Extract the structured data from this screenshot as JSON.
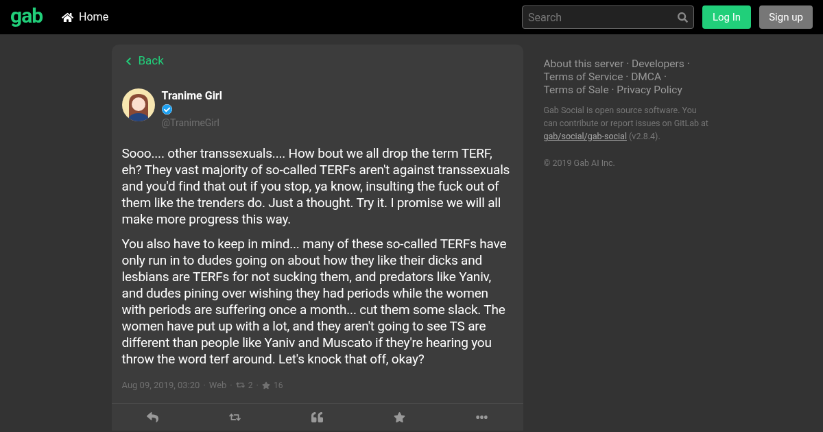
{
  "header": {
    "logo": "gab",
    "nav": [
      {
        "label": "Home",
        "selected": false
      }
    ],
    "search": {
      "placeholder": "Search"
    },
    "buttons": [
      {
        "label": "Log In",
        "kind": "primary"
      },
      {
        "label": "Sign up",
        "kind": "secondary"
      }
    ]
  },
  "post": {
    "back": "Back",
    "author": {
      "name": "Tranime Girl",
      "verified": true,
      "handle": "@TranimeGirl"
    },
    "paragraphs": [
      "Sooo.... other transsexuals.... How bout we all drop the term TERF, eh? They vast majority of so-called TERFs aren't against transsexuals and you'd find that out if you stop, ya know, insulting the fuck out of them like the trenders do. Just a thought. Try it. I promise we will all make more progress this way.",
      "You also have to keep in mind... many of these so-called TERFs have only run in to dudes going on about how they like their dicks and lesbians are TERFs for not sucking them, and predators like Yaniv, and dudes pining over wishing they had periods while the women with periods are suffering once a month... cut them some slack. The women have put up with a lot, and they aren't going to see TS are different than people like Yaniv and Muscato if they're hearing you throw the word terf around. Let's knock that off, okay?"
    ],
    "date": "Aug 09, 2019, 03:20",
    "source": "Web",
    "reposts": "2",
    "favourites": "16",
    "actions": [
      {
        "kind": "reply"
      },
      {
        "kind": "repost"
      },
      {
        "kind": "quote"
      },
      {
        "kind": "favourite"
      },
      {
        "kind": "more"
      }
    ]
  },
  "sidebar": {
    "links": [
      "About this server",
      "Developers",
      "Terms of Service",
      "DMCA",
      "Terms of Sale",
      "Privacy Policy"
    ],
    "about": {
      "text_before": "Gab Social is open source software. You can contribute or report issues on GitLab at",
      "link": "gab/social/gab-social",
      "text_after": "(v2.8.4)."
    },
    "copyright": "© 2019 Gab AI Inc."
  },
  "separator": "·"
}
